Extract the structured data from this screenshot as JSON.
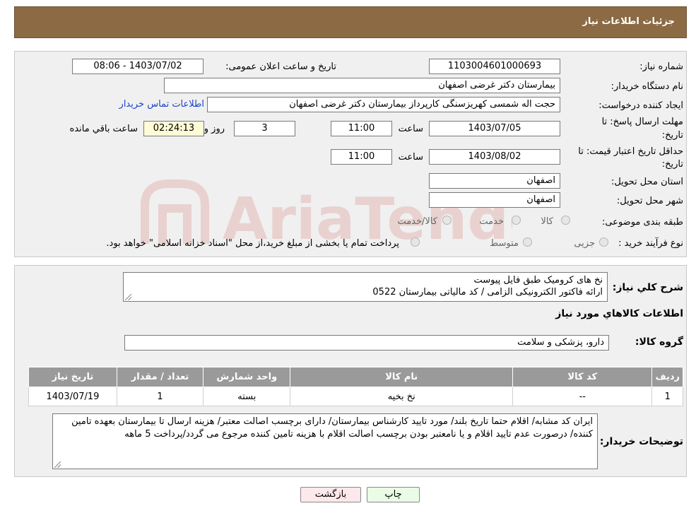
{
  "header": {
    "title": "جزئیات اطلاعات نیاز"
  },
  "watermark": {
    "text": "AriaTender.neT",
    "color": "#c0392b"
  },
  "need": {
    "number_label": "شماره نیاز:",
    "number_value": "1103004601000693",
    "announce_label": "تاریخ و ساعت اعلان عمومی:",
    "announce_value": "1403/07/02 - 08:06",
    "buyer_label": "نام دستگاه خریدار:",
    "buyer_value": "بیمارستان دکتر غرضی اصفهان",
    "creator_label": "ایجاد کننده درخواست:",
    "creator_value": "حجت اله شمسی کهریزسنگی کارپرداز بیمارستان دکتر غرضی اصفهان",
    "contact_link": "اطلاعات تماس خریدار",
    "deadline_label_1": "مهلت ارسال پاسخ: تا",
    "deadline_label_2": "تاریخ:",
    "deadline_date": "1403/07/05",
    "time_label": "ساعت",
    "deadline_time": "11:00",
    "days_value": "3",
    "days_label": "روز و",
    "remaining_value": "02:24:13",
    "remaining_label": "ساعت باقي مانده",
    "validity_label_1": "حداقل تاریخ اعتبار قیمت: تا",
    "validity_label_2": "تاریخ:",
    "validity_date": "1403/08/02",
    "validity_time": "11:00",
    "province_label": "استان محل تحویل:",
    "province_value": "اصفهان",
    "city_label": "شهر محل تحویل:",
    "city_value": "اصفهان",
    "category_label": "طبقه بندی موضوعی:",
    "category_options": [
      "کالا",
      "خدمت",
      "کالا/خدمت"
    ],
    "process_label": "نوع فرآیند خرید :",
    "process_options": [
      "جزیی",
      "متوسط"
    ],
    "process_note": "پرداخت تمام یا بخشی از مبلغ خرید،از محل \"اسناد خزانه اسلامی\" خواهد بود."
  },
  "description": {
    "label": "شرح کلي نياز:",
    "line1": "نخ های کرومیک طبق فایل پیوست",
    "line2": "ارائه فاکتور الکترونیکی الزامی / کد مالیاتی بیمارستان 0522"
  },
  "goods": {
    "section_title": "اطلاعات کالاهاي مورد نياز",
    "group_label": "گروه کالا:",
    "group_value": "دارو، پزشکی و سلامت",
    "columns": [
      "رديف",
      "کد کالا",
      "نام کالا",
      "واحد شمارش",
      "تعداد / مقدار",
      "تاریخ نیاز"
    ],
    "rows": [
      [
        "1",
        "--",
        "نخ بخیه",
        "بسته",
        "1",
        "1403/07/19"
      ]
    ]
  },
  "buyer_notes": {
    "label": "توضیحات خریدار:",
    "text": "ایران کد مشابه/ اقلام حتما تاریخ بلند/ مورد تایید کارشناس بیمارستان/ دارای برچسب اصالت معتبر/ هزینه ارسال تا بیمارستان بعهده تامین کننده/ درصورت عدم تایید اقلام و یا نامعتبر بودن برچسب اصالت اقلام با هزینه تامین کننده مرجوع می گردد/پرداخت 5 ماهه"
  },
  "buttons": {
    "back": "بازگشت",
    "print": "چاپ"
  }
}
